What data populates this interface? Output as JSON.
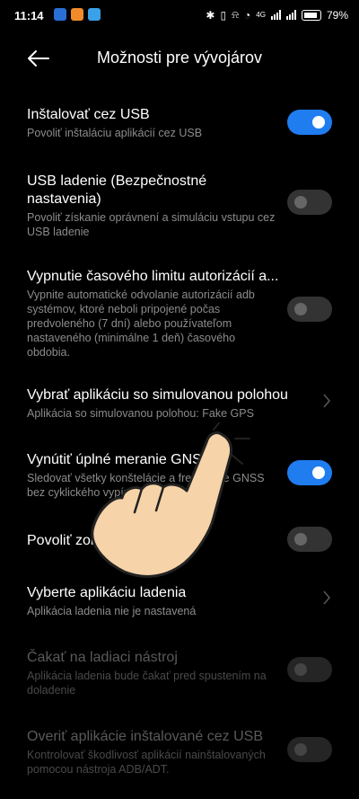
{
  "status_bar": {
    "time": "11:14",
    "battery_percent": "79",
    "network": "4G",
    "icons": [
      "bluetooth-icon",
      "vibrate-icon",
      "alarm-off-icon",
      "alarm-icon",
      "signal-icon",
      "battery-icon"
    ]
  },
  "header": {
    "title": "Možnosti pre vývojárov"
  },
  "settings": [
    {
      "title": "Inštalovať cez USB",
      "subtitle": "Povoliť inštaláciu aplikácií cez USB",
      "control": "toggle",
      "state": "on"
    },
    {
      "title": "USB ladenie (Bezpečnostné nastavenia)",
      "subtitle": "Povoliť získanie oprávnení a simuláciu vstupu cez USB ladenie",
      "control": "toggle",
      "state": "off"
    },
    {
      "title": "Vypnutie časového limitu autorizácií a...",
      "subtitle": "Vypnite automatické odvolanie autorizácií adb systémov, ktoré neboli pripojené počas predvoleného (7 dní) alebo používateľom nastaveného (minimálne 1 deň) časového obdobia.",
      "control": "toggle",
      "state": "off"
    },
    {
      "title": "Vybrať aplikáciu so simulovanou polohou",
      "subtitle": "Aplikácia so simulovanou polohou: Fake GPS",
      "control": "chevron"
    },
    {
      "title": "Vynútiť úplné meranie GNSS",
      "subtitle": "Sledovať všetky konštelácie a frekvencie GNSS bez cyklického vypínania",
      "control": "toggle",
      "state": "on"
    },
    {
      "title": "Povoliť zobrazenie atribútov",
      "subtitle": "",
      "control": "toggle",
      "state": "off"
    },
    {
      "title": "Vyberte aplikáciu ladenia",
      "subtitle": "Aplikácia ladenia nie je nastavená",
      "control": "chevron"
    },
    {
      "title": "Čakať na ladiaci nástroj",
      "subtitle": "Aplikácia ladenia bude čakať pred spustením na doladenie",
      "control": "toggle",
      "state": "off",
      "disabled": true
    },
    {
      "title": "Overiť aplikácie inštalované cez USB",
      "subtitle": "Kontrolovať škodlivosť aplikácií nainštalovaných pomocou nástroja ADB/ADT.",
      "control": "toggle",
      "state": "off",
      "disabled": true
    }
  ],
  "colors": {
    "accent": "#1f7df0",
    "background": "#000000",
    "subtitle": "#8c8c8c",
    "hand": "#f6d3a8"
  }
}
